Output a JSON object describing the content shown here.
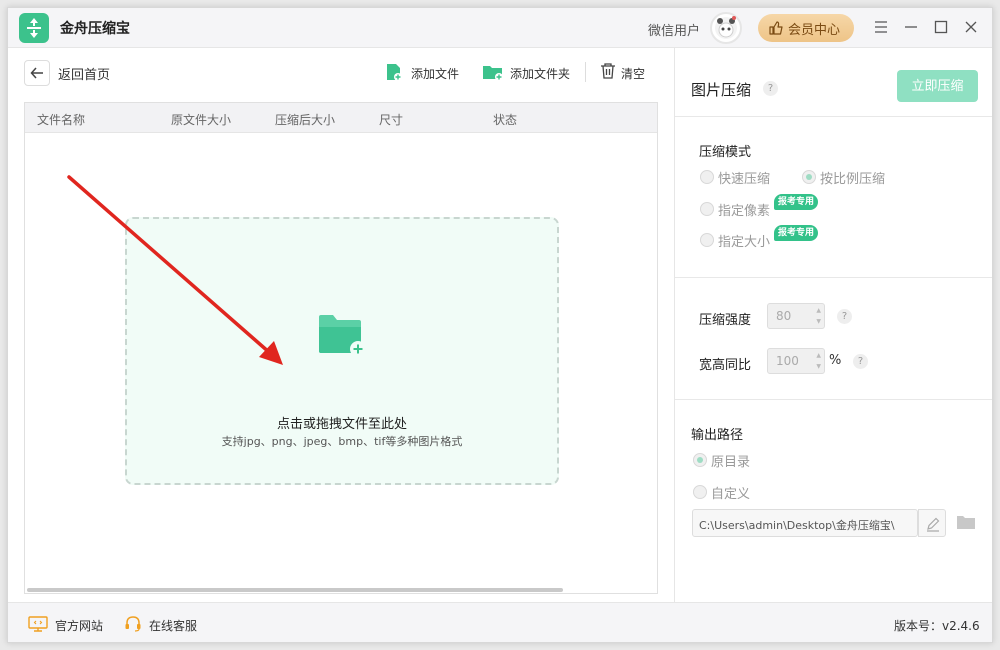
{
  "titlebar": {
    "app_name": "金舟压缩宝",
    "user_name": "微信用户",
    "member_label": "会员中心"
  },
  "toolbar": {
    "back_label": "返回首页",
    "add_file": "添加文件",
    "add_folder": "添加文件夹",
    "clear": "清空"
  },
  "table": {
    "columns": [
      "文件名称",
      "原文件大小",
      "压缩后大小",
      "尺寸",
      "状态"
    ]
  },
  "drop_zone": {
    "title": "点击或拖拽文件至此处",
    "subtitle": "支持jpg、png、jpeg、bmp、tif等多种图片格式"
  },
  "panel": {
    "title": "图片压缩",
    "compress_button": "立即压缩",
    "mode_label": "压缩模式",
    "modes": [
      {
        "label": "快速压缩",
        "selected": false
      },
      {
        "label": "按比例压缩",
        "selected": true
      },
      {
        "label": "指定像素",
        "selected": false,
        "badge": "报考专用"
      },
      {
        "label": "指定大小",
        "selected": false,
        "badge": "报考专用"
      }
    ],
    "strength_label": "压缩强度",
    "strength_value": "80",
    "ratio_label": "宽高同比",
    "ratio_value": "100",
    "ratio_unit": "%",
    "output_label": "输出路径",
    "output_options": [
      {
        "label": "原目录",
        "selected": true
      },
      {
        "label": "自定义",
        "selected": false
      }
    ],
    "output_path": "C:\\Users\\admin\\Desktop\\金舟压缩宝\\"
  },
  "footer": {
    "website": "官方网站",
    "support": "在线客服",
    "version": "版本号：v2.4.6"
  },
  "colors": {
    "accent": "#3cc28c",
    "drop_bg": "#f1fcf7",
    "badge": "#33c28a",
    "arrow": "#e0261f"
  }
}
